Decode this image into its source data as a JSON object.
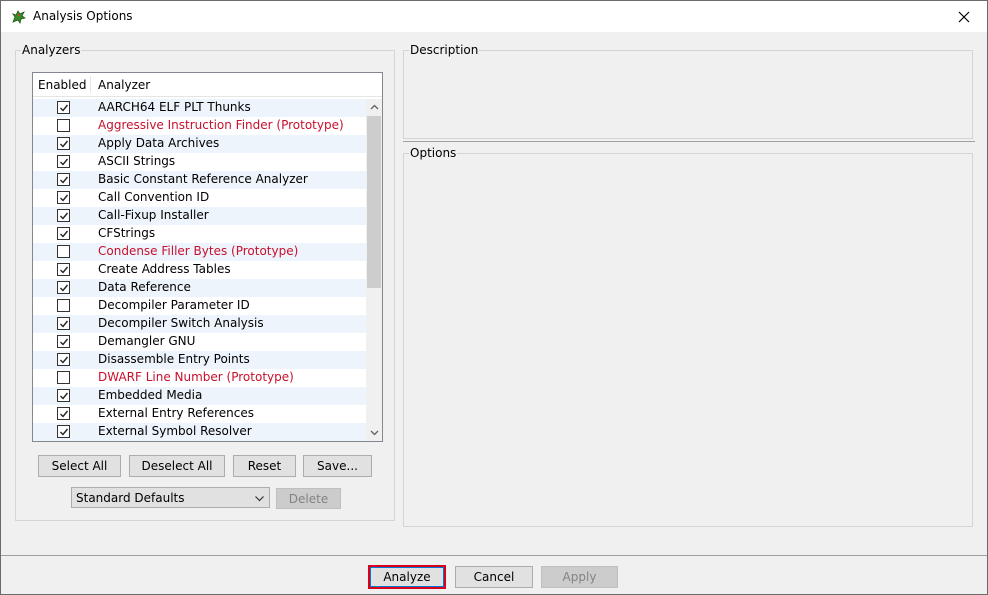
{
  "window": {
    "title": "Analysis Options"
  },
  "analyzers": {
    "legend": "Analyzers",
    "headers": {
      "enabled": "Enabled",
      "analyzer": "Analyzer"
    },
    "items": [
      {
        "label": "AARCH64 ELF PLT Thunks",
        "checked": true,
        "prototype": false
      },
      {
        "label": "Aggressive Instruction Finder (Prototype)",
        "checked": false,
        "prototype": true
      },
      {
        "label": "Apply Data Archives",
        "checked": true,
        "prototype": false
      },
      {
        "label": "ASCII Strings",
        "checked": true,
        "prototype": false
      },
      {
        "label": "Basic Constant Reference Analyzer",
        "checked": true,
        "prototype": false
      },
      {
        "label": "Call Convention ID",
        "checked": true,
        "prototype": false
      },
      {
        "label": "Call-Fixup Installer",
        "checked": true,
        "prototype": false
      },
      {
        "label": "CFStrings",
        "checked": true,
        "prototype": false
      },
      {
        "label": "Condense Filler Bytes (Prototype)",
        "checked": false,
        "prototype": true
      },
      {
        "label": "Create Address Tables",
        "checked": true,
        "prototype": false
      },
      {
        "label": "Data Reference",
        "checked": true,
        "prototype": false
      },
      {
        "label": "Decompiler Parameter ID",
        "checked": false,
        "prototype": false
      },
      {
        "label": "Decompiler Switch Analysis",
        "checked": true,
        "prototype": false
      },
      {
        "label": "Demangler GNU",
        "checked": true,
        "prototype": false
      },
      {
        "label": "Disassemble Entry Points",
        "checked": true,
        "prototype": false
      },
      {
        "label": "DWARF Line Number (Prototype)",
        "checked": false,
        "prototype": true
      },
      {
        "label": "Embedded Media",
        "checked": true,
        "prototype": false
      },
      {
        "label": "External Entry References",
        "checked": true,
        "prototype": false
      },
      {
        "label": "External Symbol Resolver",
        "checked": true,
        "prototype": false
      }
    ],
    "buttons": {
      "select_all": "Select All",
      "deselect_all": "Deselect All",
      "reset": "Reset",
      "save": "Save..."
    },
    "profile": {
      "selected": "Standard Defaults",
      "delete_label": "Delete"
    }
  },
  "description": {
    "legend": "Description"
  },
  "options": {
    "legend": "Options"
  },
  "footer": {
    "analyze_label": "Analyze",
    "cancel_label": "Cancel",
    "apply_label": "Apply"
  },
  "colors": {
    "prototype_text": "#c8102e",
    "alt_row": "#eef4fb",
    "focus_border": "#d9001b"
  }
}
